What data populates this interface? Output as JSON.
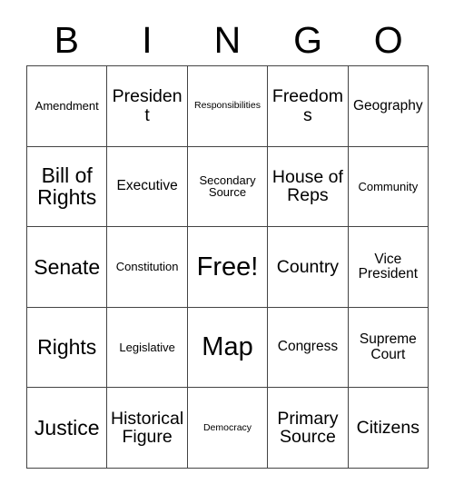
{
  "card": {
    "header_letters": [
      "B",
      "I",
      "N",
      "G",
      "O"
    ],
    "rows": [
      [
        {
          "text": "Amendment",
          "size": "sm"
        },
        {
          "text": "President",
          "size": "lg"
        },
        {
          "text": "Responsibilities",
          "size": "xs"
        },
        {
          "text": "Freedoms",
          "size": "lg"
        },
        {
          "text": "Geography",
          "size": "md"
        }
      ],
      [
        {
          "text": "Bill of Rights",
          "size": "xl"
        },
        {
          "text": "Executive",
          "size": "md"
        },
        {
          "text": "Secondary Source",
          "size": "sm"
        },
        {
          "text": "House of Reps",
          "size": "lg"
        },
        {
          "text": "Community",
          "size": "sm"
        }
      ],
      [
        {
          "text": "Senate",
          "size": "xl"
        },
        {
          "text": "Constitution",
          "size": "sm"
        },
        {
          "text": "Free!",
          "size": "xxl"
        },
        {
          "text": "Country",
          "size": "lg"
        },
        {
          "text": "Vice President",
          "size": "md"
        }
      ],
      [
        {
          "text": "Rights",
          "size": "xl"
        },
        {
          "text": "Legislative",
          "size": "sm"
        },
        {
          "text": "Map",
          "size": "xxl"
        },
        {
          "text": "Congress",
          "size": "md"
        },
        {
          "text": "Supreme Court",
          "size": "md"
        }
      ],
      [
        {
          "text": "Justice",
          "size": "xl"
        },
        {
          "text": "Historical Figure",
          "size": "lg"
        },
        {
          "text": "Democracy",
          "size": "xs"
        },
        {
          "text": "Primary Source",
          "size": "lg"
        },
        {
          "text": "Citizens",
          "size": "lg"
        }
      ]
    ]
  }
}
